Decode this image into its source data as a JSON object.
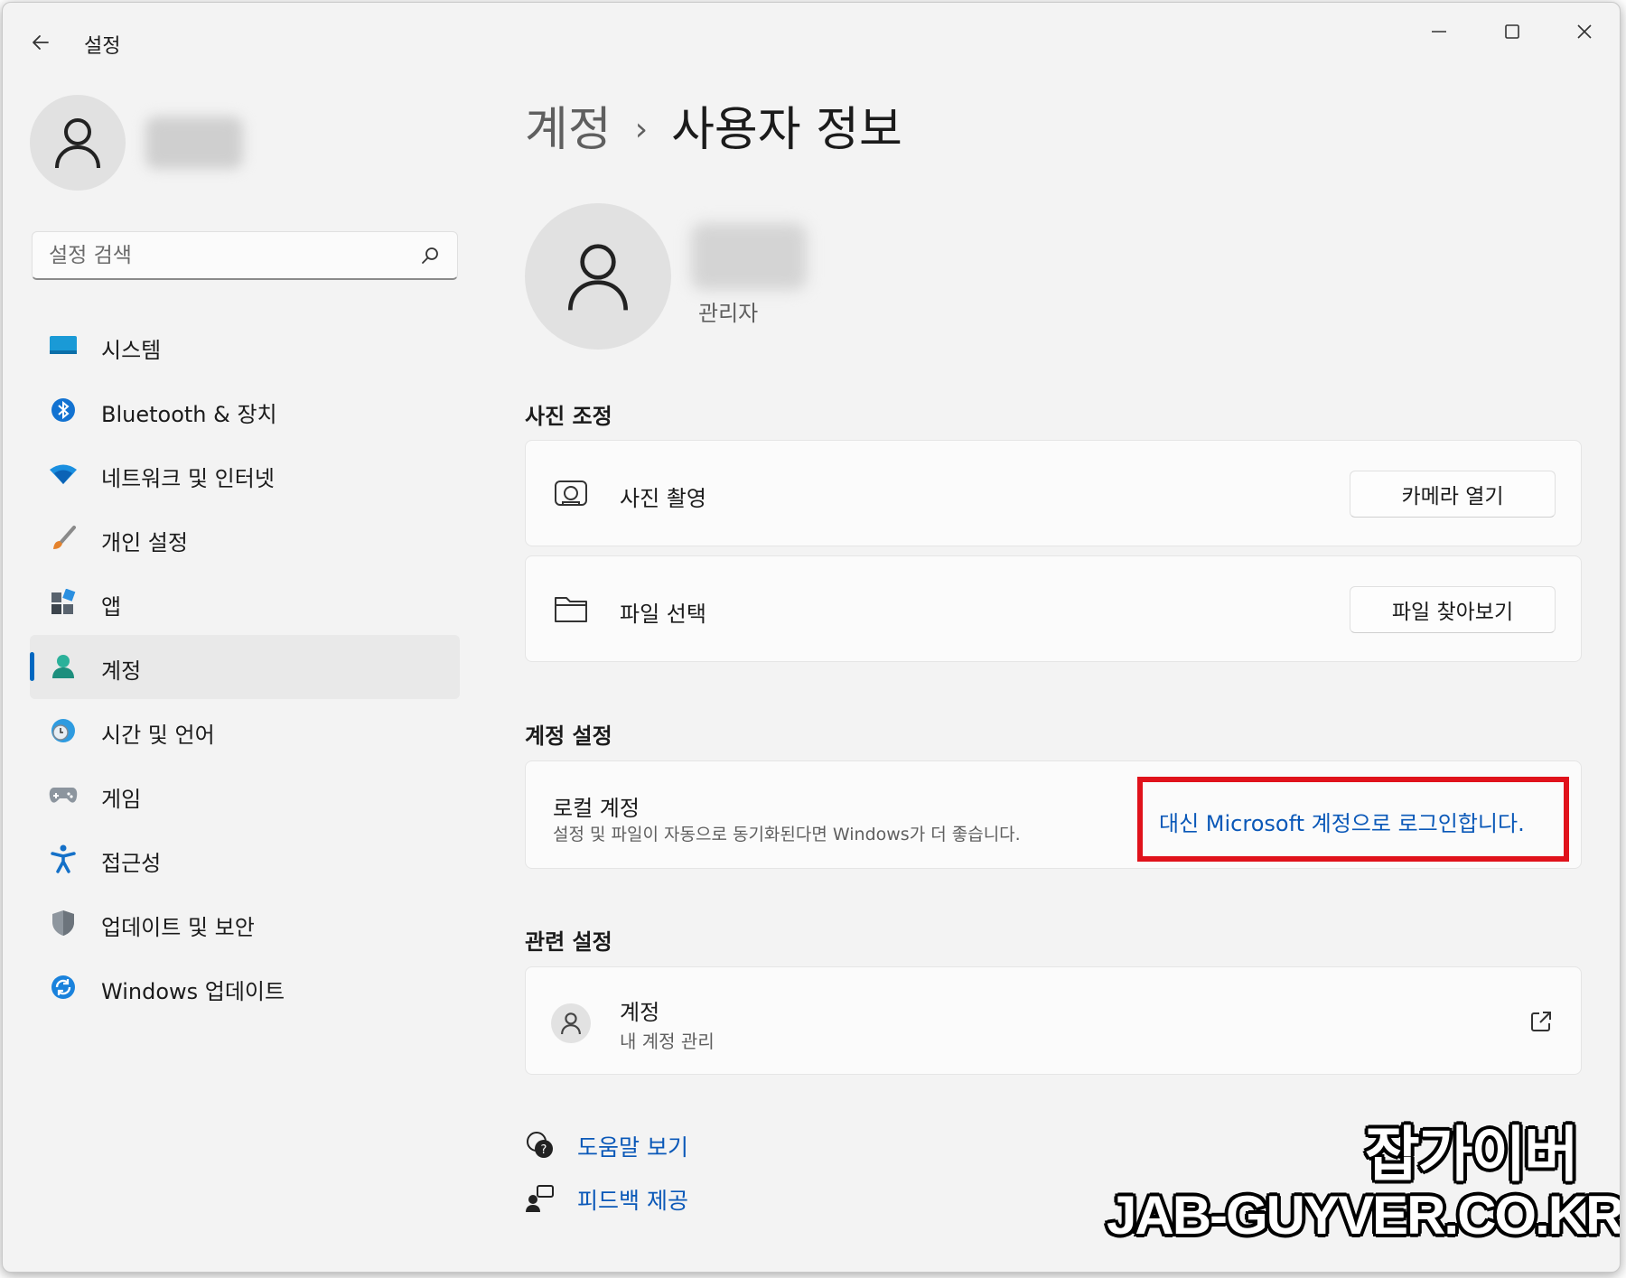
{
  "window": {
    "title": "설정"
  },
  "sidebar": {
    "search_placeholder": "설정 검색",
    "items": [
      {
        "label": "시스템",
        "icon": "monitor-icon"
      },
      {
        "label": "Bluetooth & 장치",
        "icon": "bluetooth-icon"
      },
      {
        "label": "네트워크 및 인터넷",
        "icon": "wifi-icon"
      },
      {
        "label": "개인 설정",
        "icon": "brush-icon"
      },
      {
        "label": "앱",
        "icon": "apps-icon"
      },
      {
        "label": "계정",
        "icon": "account-icon",
        "selected": true
      },
      {
        "label": "시간 및 언어",
        "icon": "clock-globe-icon"
      },
      {
        "label": "게임",
        "icon": "gamepad-icon"
      },
      {
        "label": "접근성",
        "icon": "accessibility-icon"
      },
      {
        "label": "업데이트 및 보안",
        "icon": "shield-icon"
      },
      {
        "label": "Windows 업데이트",
        "icon": "windows-update-icon"
      }
    ]
  },
  "main": {
    "breadcrumb": {
      "parent": "계정",
      "separator": "›",
      "current": "사용자 정보"
    },
    "user": {
      "role": "관리자"
    },
    "photo_section": {
      "title": "사진 조정",
      "rows": [
        {
          "label": "사진 촬영",
          "button": "카메라 열기",
          "icon": "camera-icon"
        },
        {
          "label": "파일 선택",
          "button": "파일 찾아보기",
          "icon": "folder-icon"
        }
      ]
    },
    "account_section": {
      "title": "계정 설정",
      "local_title": "로컬 계정",
      "local_desc": "설정 및 파일이 자동으로 동기화된다면 Windows가 더 좋습니다.",
      "ms_link": "대신 Microsoft 계정으로 로그인합니다."
    },
    "related_section": {
      "title": "관련 설정",
      "item_title": "계정",
      "item_sub": "내 계정 관리"
    },
    "links": {
      "help": "도움말 보기",
      "feedback": "피드백 제공"
    }
  },
  "watermark": {
    "korean": "잡가이버",
    "url": "JAB-GUYVER.CO.KR"
  },
  "colors": {
    "accent": "#0067c0",
    "link": "#0a58b8",
    "highlight_box": "#e0121b",
    "background": "#f3f3f3"
  }
}
